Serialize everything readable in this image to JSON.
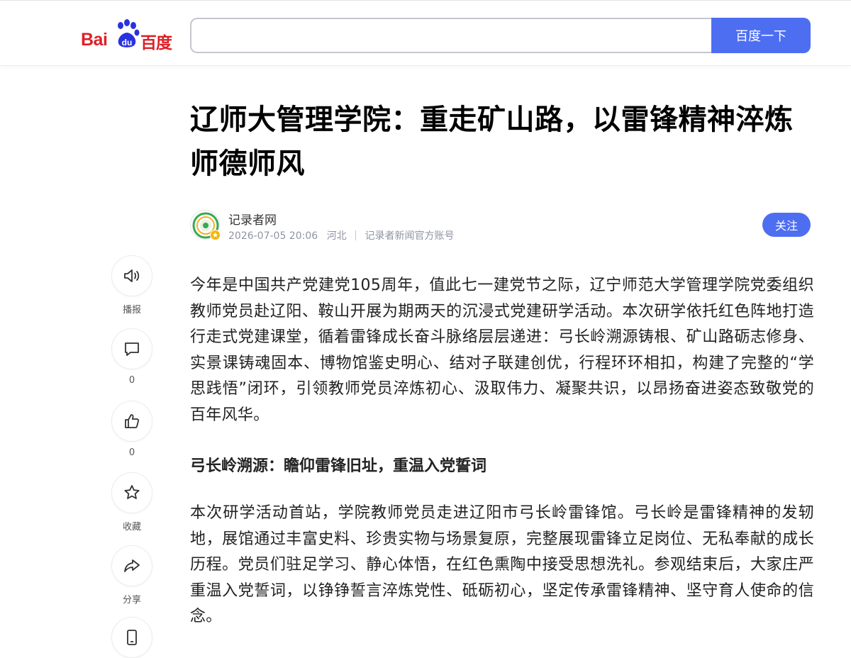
{
  "header": {
    "logo": {
      "text_bai": "Bai",
      "text_du": "du",
      "text_cn": "百度"
    },
    "search": {
      "value": "",
      "placeholder": ""
    },
    "search_button_label": "百度一下"
  },
  "article": {
    "title": "辽师大管理学院：重走矿山路，以雷锋精神淬炼师德师风",
    "author": {
      "name": "记录者网",
      "datetime": "2026-07-05 20:06",
      "location": "河北",
      "account_type": "记录者新闻官方账号"
    },
    "follow_label": "关注",
    "paragraph_1": "今年是中国共产党建党105周年，值此七一建党节之际，辽宁师范大学管理学院党委组织教师党员赴辽阳、鞍山开展为期两天的沉浸式党建研学活动。本次研学依托红色阵地打造行走式党建课堂，循着雷锋成长奋斗脉络层层递进：弓长岭溯源铸根、矿山路砺志修身、实景课铸魂固本、博物馆鉴史明心、结对子联建创优，行程环环相扣，构建了完整的“学思践悟”闭环，引领教师党员淬炼初心、汲取伟力、凝聚共识，以昂扬奋进姿态致敬党的百年风华。",
    "subheading_1": "弓长岭溯源：瞻仰雷锋旧址，重温入党誓词",
    "paragraph_2": "本次研学活动首站，学院教师党员走进辽阳市弓长岭雷锋馆。弓长岭是雷锋精神的发轫地，展馆通过丰富史料、珍贵实物与场景复原，完整展现雷锋立足岗位、无私奉献的成长历程。党员们驻足学习、静心体悟，在红色熏陶中接受思想洗礼。参观结束后，大家庄严重温入党誓词，以铮铮誓言淬炼党性、砥砺初心，坚定传承雷锋精神、坚守育人使命的信念。"
  },
  "actions": {
    "listen": {
      "icon": "speaker-icon",
      "label": "播报"
    },
    "comment": {
      "icon": "comment-icon",
      "count": "0"
    },
    "like": {
      "icon": "thumbs-up-icon",
      "count": "0"
    },
    "favorite": {
      "icon": "star-icon",
      "label": "收藏"
    },
    "share": {
      "icon": "share-arrow-icon",
      "label": "分享"
    },
    "mobile": {
      "icon": "phone-icon"
    }
  },
  "colors": {
    "brand_red": "#de1f26",
    "brand_blue": "#2932e1",
    "accent_blue": "#4e6ef2",
    "meta_gray": "#9195a3"
  }
}
